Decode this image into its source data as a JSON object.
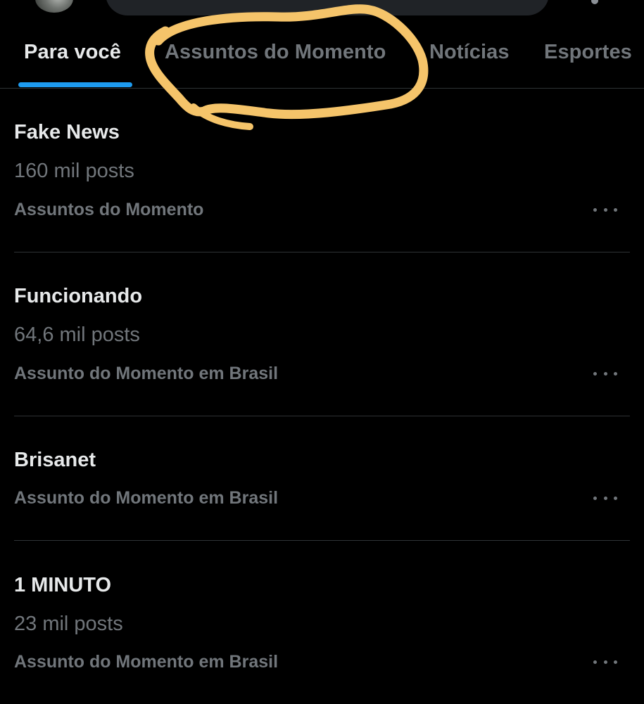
{
  "tabs": [
    {
      "label": "Para você",
      "active": true
    },
    {
      "label": "Assuntos do Momento",
      "active": false
    },
    {
      "label": "Notícias",
      "active": false
    },
    {
      "label": "Esportes",
      "active": false
    }
  ],
  "trends": [
    {
      "title": "Fake News",
      "count": "160 mil posts",
      "context": "Assuntos do Momento"
    },
    {
      "title": "Funcionando",
      "count": "64,6 mil posts",
      "context": "Assunto do Momento em Brasil"
    },
    {
      "title": "Brisanet",
      "count": "",
      "context": "Assunto do Momento em Brasil"
    },
    {
      "title": "1 MINUTO",
      "count": "23 mil posts",
      "context": "Assunto do Momento em Brasil"
    }
  ],
  "icons": {
    "more": "more-horizontal-icon",
    "avatar": "avatar"
  },
  "colors": {
    "background": "#000000",
    "text_primary": "#e7e9ea",
    "text_secondary": "#71767b",
    "accent": "#1d9bf0",
    "divider": "#2f3336",
    "scribble": "#f5c46a"
  }
}
